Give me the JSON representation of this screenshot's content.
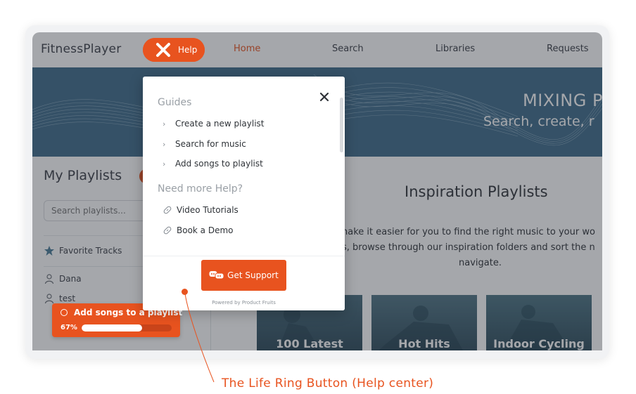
{
  "app": {
    "logo": "FitnessPlayer",
    "help_button": {
      "label": "Help",
      "icon": "close-icon"
    },
    "nav": [
      {
        "label": "Home",
        "active": true
      },
      {
        "label": "Search",
        "active": false
      },
      {
        "label": "Libraries",
        "active": false
      },
      {
        "label": "Requests",
        "active": false
      }
    ]
  },
  "hero": {
    "title": "MIXING P",
    "subtitle": "Search, create, r"
  },
  "sidebar": {
    "title": "My Playlists",
    "search_placeholder": "Search playlists...",
    "items": [
      {
        "label": "Favorite Tracks",
        "icon": "star-music-icon"
      },
      {
        "label": "Dana",
        "icon": "user-icon"
      },
      {
        "label": "test",
        "icon": "user-icon"
      }
    ]
  },
  "checklist": {
    "title": "Add songs to a playlist",
    "percent_label": "67%",
    "progress": 0.67
  },
  "main": {
    "title": "Inspiration Playlists",
    "paragraph_lines": [
      "nake it easier for you to find the right music to your wo",
      "s, browse through our inspiration folders and sort the n",
      "navigate."
    ],
    "cards": [
      {
        "label": "100 Latest"
      },
      {
        "label": "Hot Hits"
      },
      {
        "label": "Indoor Cycling"
      }
    ]
  },
  "help_popup": {
    "guides_heading": "Guides",
    "guides": [
      {
        "label": "Create a new playlist"
      },
      {
        "label": "Search for music"
      },
      {
        "label": "Add songs to playlist"
      }
    ],
    "more_help_heading": "Need more Help?",
    "links": [
      {
        "label": "Video Tutorials"
      },
      {
        "label": "Book a Demo"
      }
    ],
    "support_button": "Get Support",
    "powered_by": "Powered by Product Fruits"
  },
  "annotation": {
    "text": "The Life Ring Button (Help center)"
  },
  "colors": {
    "accent": "#e8531f",
    "hero_bg": "#3e6b8a",
    "text": "#3b3f47"
  }
}
